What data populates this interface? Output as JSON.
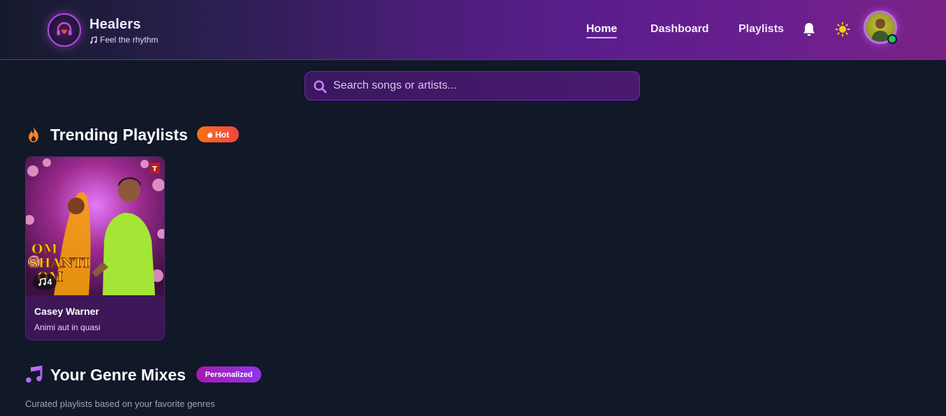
{
  "header": {
    "brand_name": "Healers",
    "tagline": "Feel the rhythm",
    "nav": [
      {
        "label": "Home",
        "active": true
      },
      {
        "label": "Dashboard",
        "active": false
      },
      {
        "label": "Playlists",
        "active": false
      }
    ],
    "icons": [
      "headphones-heart-icon",
      "bell-icon",
      "sun-icon"
    ],
    "avatar_status": "online"
  },
  "search": {
    "placeholder": "Search songs or artists..."
  },
  "trending": {
    "title": "Trending Playlists",
    "badge": "Hot",
    "playlists": [
      {
        "title": "Casey Warner",
        "subtitle": "Animi aut in quasi",
        "song_count": "4",
        "cover_text": "OM SHANTI OM"
      }
    ]
  },
  "genre_mixes": {
    "title": "Your Genre Mixes",
    "badge": "Personalized",
    "description": "Curated playlists based on your favorite genres"
  },
  "colors": {
    "background": "#111827",
    "accent_purple": "#9333ea",
    "hot_orange": "#f97316",
    "online_green": "#22c55e"
  }
}
